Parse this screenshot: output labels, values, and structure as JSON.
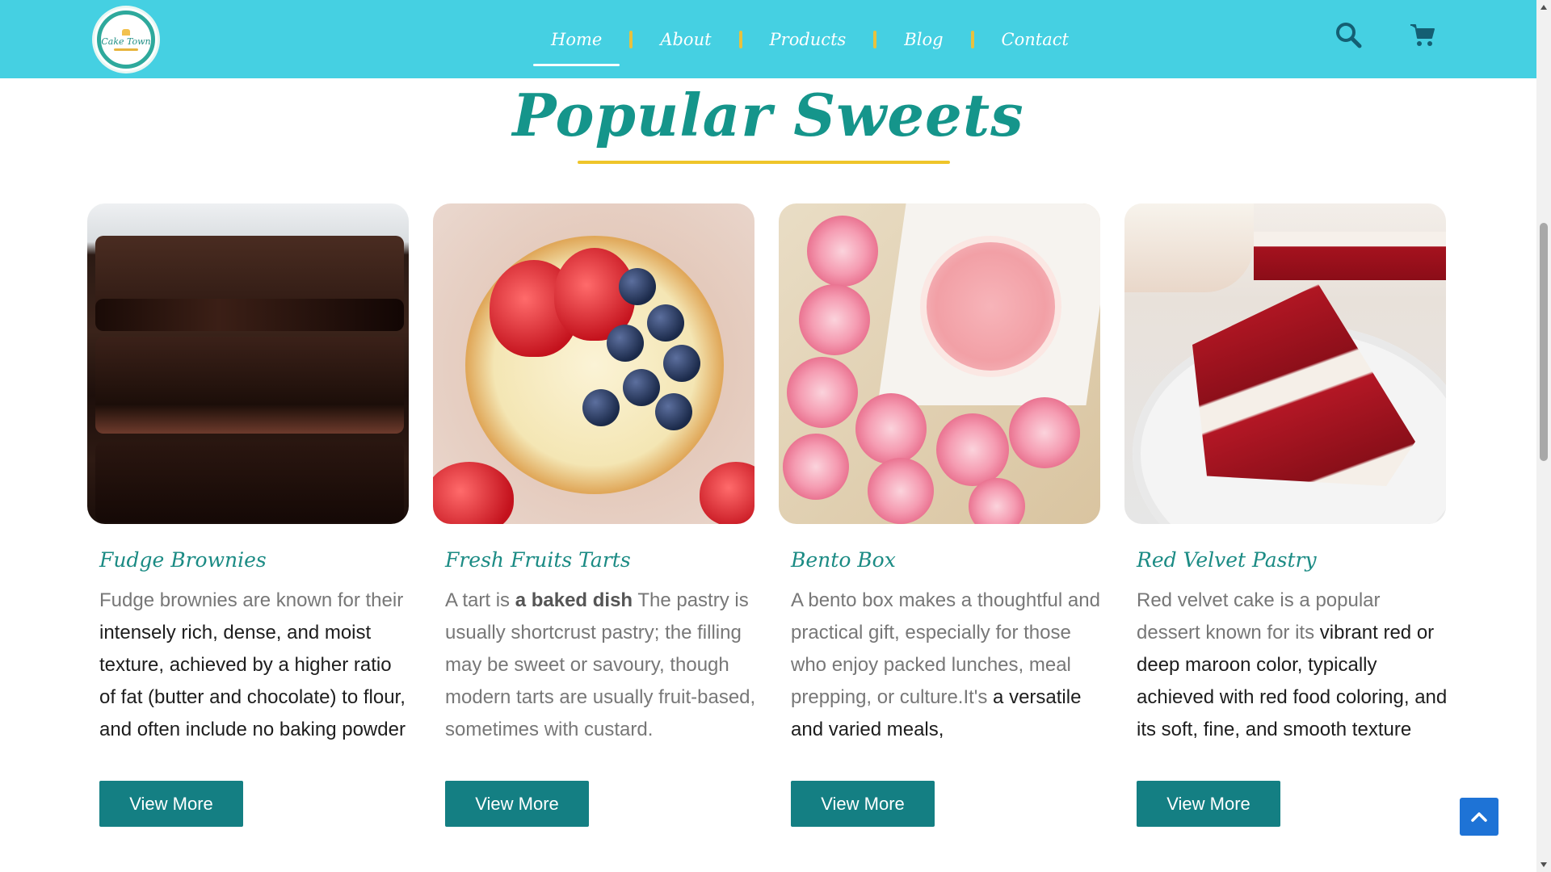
{
  "header": {
    "logo_text": "Cake Town",
    "nav": [
      {
        "label": "Home",
        "active": true
      },
      {
        "label": "About",
        "active": false
      },
      {
        "label": "Products",
        "active": false
      },
      {
        "label": "Blog",
        "active": false
      },
      {
        "label": "Contact",
        "active": false
      }
    ],
    "icons": [
      "search-icon",
      "cart-icon"
    ],
    "accent_color": "#45d0e2"
  },
  "section": {
    "title": "Popular Sweets",
    "title_color": "#15958b",
    "underline_color": "#efc52a"
  },
  "cards": [
    {
      "title": "Fudge Brownies",
      "desc_a": "Fudge brownies are known for their ",
      "desc_b": "intensely rich, dense, and moist texture, achieved by a higher ratio of fat (butter and chocolate) to flour, and often include no baking powder",
      "button": "View More"
    },
    {
      "title": "Fresh Fruits Tarts",
      "desc_a": "A tart is ",
      "desc_bold": "a baked dish",
      "desc_b": "  The pastry is usually shortcrust pastry; the filling may be sweet or savoury, though modern tarts are usually fruit-based, sometimes with custard.",
      "button": "View More"
    },
    {
      "title": "Bento Box",
      "desc_a": "A bento box makes a thoughtful and practical gift, especially for those who enjoy packed lunches, meal prepping, or culture.It's ",
      "desc_b": "a versatile and varied meals",
      "desc_c": ",",
      "button": "View More"
    },
    {
      "title": "Red Velvet Pastry",
      "desc_a": "Red velvet cake is a popular dessert known for its ",
      "desc_b": "vibrant red or deep maroon color, typically achieved with red food coloring, and its soft, fine, and smooth texture",
      "button": "View More"
    }
  ],
  "button_color": "#147f83",
  "back_to_top_icon": "chevron-up-icon",
  "back_to_top_color": "#1e73d6"
}
